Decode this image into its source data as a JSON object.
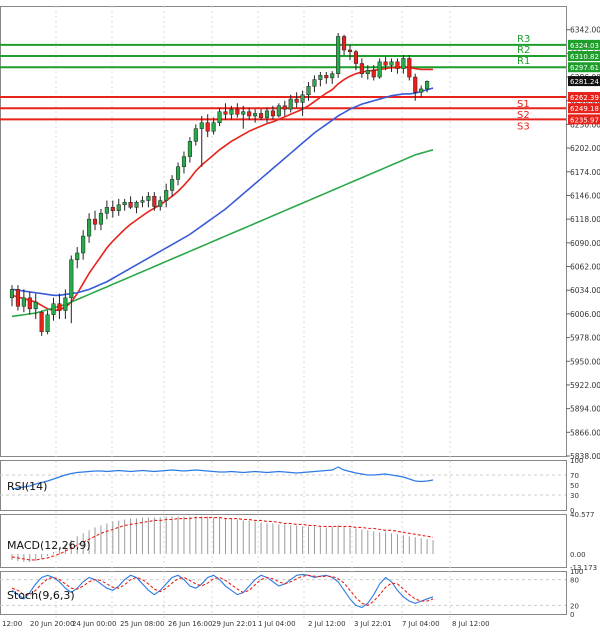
{
  "chart_data": [
    {
      "type": "candlestick",
      "panel": "price",
      "ylim": [
        5838,
        6370
      ],
      "y_ticks": [
        6342,
        6314,
        6286,
        6258,
        6230,
        6202,
        6174,
        6146,
        6118,
        6090,
        6062,
        6034,
        6006,
        5978,
        5950,
        5922,
        5894,
        5866,
        5838
      ],
      "x_ticks": [
        "12:00",
        "20 Jun 20:00",
        "24 Jun 00:00",
        "25 Jun 08:00",
        "26 Jun 16:00",
        "29 Jun 22:01",
        "1 Jul 04:00",
        "2 Jul 12:00",
        "3 Jul 22:01",
        "7 Jul 04:00",
        "8 Jul 12:00"
      ],
      "last_price": 6281.24,
      "candles": [
        {
          "o": 6025,
          "h": 6040,
          "l": 6015,
          "c": 6035
        },
        {
          "o": 6035,
          "h": 6040,
          "l": 6010,
          "c": 6015
        },
        {
          "o": 6015,
          "h": 6035,
          "l": 6008,
          "c": 6025
        },
        {
          "o": 6025,
          "h": 6032,
          "l": 6005,
          "c": 6012
        },
        {
          "o": 6012,
          "h": 6030,
          "l": 6000,
          "c": 6020
        },
        {
          "o": 6008,
          "h": 6010,
          "l": 5980,
          "c": 5985
        },
        {
          "o": 5985,
          "h": 6010,
          "l": 5982,
          "c": 6005
        },
        {
          "o": 6005,
          "h": 6025,
          "l": 5998,
          "c": 6018
        },
        {
          "o": 6018,
          "h": 6030,
          "l": 6000,
          "c": 6010
        },
        {
          "o": 6010,
          "h": 6035,
          "l": 6000,
          "c": 6025
        },
        {
          "o": 6025,
          "h": 6075,
          "l": 5995,
          "c": 6070
        },
        {
          "o": 6070,
          "h": 6085,
          "l": 6060,
          "c": 6078
        },
        {
          "o": 6078,
          "h": 6105,
          "l": 6070,
          "c": 6098
        },
        {
          "o": 6098,
          "h": 6125,
          "l": 6090,
          "c": 6118
        },
        {
          "o": 6118,
          "h": 6128,
          "l": 6105,
          "c": 6112
        },
        {
          "o": 6112,
          "h": 6130,
          "l": 6105,
          "c": 6125
        },
        {
          "o": 6125,
          "h": 6140,
          "l": 6118,
          "c": 6132
        },
        {
          "o": 6132,
          "h": 6140,
          "l": 6120,
          "c": 6128
        },
        {
          "o": 6128,
          "h": 6142,
          "l": 6122,
          "c": 6135
        },
        {
          "o": 6135,
          "h": 6142,
          "l": 6128,
          "c": 6138
        },
        {
          "o": 6138,
          "h": 6145,
          "l": 6130,
          "c": 6132
        },
        {
          "o": 6132,
          "h": 6140,
          "l": 6125,
          "c": 6138
        },
        {
          "o": 6138,
          "h": 6145,
          "l": 6132,
          "c": 6140
        },
        {
          "o": 6140,
          "h": 6150,
          "l": 6132,
          "c": 6145
        },
        {
          "o": 6145,
          "h": 6150,
          "l": 6128,
          "c": 6133
        },
        {
          "o": 6133,
          "h": 6145,
          "l": 6128,
          "c": 6140
        },
        {
          "o": 6140,
          "h": 6160,
          "l": 6132,
          "c": 6152
        },
        {
          "o": 6152,
          "h": 6170,
          "l": 6145,
          "c": 6165
        },
        {
          "o": 6165,
          "h": 6185,
          "l": 6158,
          "c": 6180
        },
        {
          "o": 6180,
          "h": 6198,
          "l": 6172,
          "c": 6192
        },
        {
          "o": 6192,
          "h": 6215,
          "l": 6185,
          "c": 6210
        },
        {
          "o": 6210,
          "h": 6230,
          "l": 6205,
          "c": 6225
        },
        {
          "o": 6225,
          "h": 6240,
          "l": 6180,
          "c": 6232
        },
        {
          "o": 6232,
          "h": 6242,
          "l": 6215,
          "c": 6222
        },
        {
          "o": 6222,
          "h": 6238,
          "l": 6218,
          "c": 6232
        },
        {
          "o": 6232,
          "h": 6250,
          "l": 6228,
          "c": 6245
        },
        {
          "o": 6245,
          "h": 6255,
          "l": 6235,
          "c": 6242
        },
        {
          "o": 6242,
          "h": 6252,
          "l": 6236,
          "c": 6248
        },
        {
          "o": 6248,
          "h": 6255,
          "l": 6238,
          "c": 6242
        },
        {
          "o": 6242,
          "h": 6252,
          "l": 6225,
          "c": 6245
        },
        {
          "o": 6245,
          "h": 6250,
          "l": 6235,
          "c": 6240
        },
        {
          "o": 6240,
          "h": 6248,
          "l": 6232,
          "c": 6243
        },
        {
          "o": 6243,
          "h": 6248,
          "l": 6235,
          "c": 6238
        },
        {
          "o": 6238,
          "h": 6250,
          "l": 6232,
          "c": 6246
        },
        {
          "o": 6246,
          "h": 6252,
          "l": 6236,
          "c": 6240
        },
        {
          "o": 6240,
          "h": 6255,
          "l": 6238,
          "c": 6252
        },
        {
          "o": 6252,
          "h": 6258,
          "l": 6240,
          "c": 6248
        },
        {
          "o": 6248,
          "h": 6265,
          "l": 6244,
          "c": 6260
        },
        {
          "o": 6260,
          "h": 6268,
          "l": 6250,
          "c": 6256
        },
        {
          "o": 6256,
          "h": 6270,
          "l": 6240,
          "c": 6265
        },
        {
          "o": 6265,
          "h": 6280,
          "l": 6258,
          "c": 6275
        },
        {
          "o": 6275,
          "h": 6288,
          "l": 6268,
          "c": 6283
        },
        {
          "o": 6283,
          "h": 6292,
          "l": 6275,
          "c": 6288
        },
        {
          "o": 6288,
          "h": 6292,
          "l": 6278,
          "c": 6285
        },
        {
          "o": 6285,
          "h": 6293,
          "l": 6278,
          "c": 6290
        },
        {
          "o": 6290,
          "h": 6338,
          "l": 6285,
          "c": 6334
        },
        {
          "o": 6334,
          "h": 6336,
          "l": 6312,
          "c": 6318
        },
        {
          "o": 6318,
          "h": 6324,
          "l": 6306,
          "c": 6316
        },
        {
          "o": 6316,
          "h": 6318,
          "l": 6294,
          "c": 6302
        },
        {
          "o": 6302,
          "h": 6308,
          "l": 6285,
          "c": 6290
        },
        {
          "o": 6290,
          "h": 6300,
          "l": 6283,
          "c": 6294
        },
        {
          "o": 6294,
          "h": 6300,
          "l": 6282,
          "c": 6286
        },
        {
          "o": 6286,
          "h": 6308,
          "l": 6284,
          "c": 6304
        },
        {
          "o": 6304,
          "h": 6310,
          "l": 6294,
          "c": 6300
        },
        {
          "o": 6300,
          "h": 6308,
          "l": 6292,
          "c": 6304
        },
        {
          "o": 6304,
          "h": 6308,
          "l": 6290,
          "c": 6296
        },
        {
          "o": 6296,
          "h": 6312,
          "l": 6290,
          "c": 6308
        },
        {
          "o": 6308,
          "h": 6312,
          "l": 6282,
          "c": 6286
        },
        {
          "o": 6286,
          "h": 6290,
          "l": 6258,
          "c": 6268
        },
        {
          "o": 6268,
          "h": 6276,
          "l": 6262,
          "c": 6272
        },
        {
          "o": 6272,
          "h": 6282,
          "l": 6268,
          "c": 6281
        }
      ],
      "moving_averages": [
        {
          "color": "#e8221b",
          "values": [
            6028,
            6026,
            6024,
            6022,
            6020,
            6016,
            6012,
            6010,
            6011,
            6014,
            6020,
            6030,
            6042,
            6054,
            6064,
            6074,
            6084,
            6092,
            6099,
            6106,
            6112,
            6117,
            6122,
            6127,
            6131,
            6135,
            6140,
            6145,
            6151,
            6158,
            6166,
            6175,
            6182,
            6188,
            6194,
            6200,
            6205,
            6210,
            6214,
            6218,
            6222,
            6225,
            6228,
            6231,
            6233,
            6236,
            6239,
            6242,
            6245,
            6248,
            6252,
            6257,
            6262,
            6267,
            6271,
            6278,
            6283,
            6287,
            6290,
            6292,
            6293,
            6294,
            6295,
            6296,
            6297,
            6297,
            6298,
            6297,
            6296,
            6295,
            6295,
            6295
          ]
        },
        {
          "color": "#3a5bd9",
          "values": [
            6035,
            6034,
            6033,
            6032,
            6031,
            6030,
            6029,
            6028,
            6028,
            6029,
            6030,
            6031,
            6033,
            6035,
            6038,
            6041,
            6044,
            6048,
            6052,
            6056,
            6060,
            6064,
            6068,
            6072,
            6076,
            6080,
            6084,
            6088,
            6092,
            6096,
            6100,
            6105,
            6110,
            6115,
            6120,
            6125,
            6130,
            6136,
            6142,
            6148,
            6154,
            6160,
            6166,
            6172,
            6178,
            6184,
            6190,
            6196,
            6202,
            6208,
            6214,
            6220,
            6225,
            6230,
            6235,
            6240,
            6244,
            6248,
            6251,
            6254,
            6256,
            6258,
            6260,
            6262,
            6264,
            6265,
            6266,
            6266,
            6267,
            6269,
            6271,
            6273
          ]
        },
        {
          "color": "#2aa84a",
          "values": [
            6003,
            6004,
            6005,
            6006,
            6007,
            6009,
            6011,
            6013,
            6015,
            6017,
            6020,
            6023,
            6026,
            6029,
            6032,
            6035,
            6038,
            6041,
            6044,
            6047,
            6050,
            6053,
            6056,
            6059,
            6062,
            6065,
            6068,
            6071,
            6074,
            6077,
            6080,
            6083,
            6086,
            6089,
            6092,
            6095,
            6098,
            6101,
            6104,
            6107,
            6110,
            6113,
            6116,
            6119,
            6122,
            6125,
            6128,
            6131,
            6134,
            6137,
            6140,
            6143,
            6146,
            6149,
            6152,
            6155,
            6158,
            6161,
            6164,
            6167,
            6170,
            6173,
            6176,
            6179,
            6182,
            6185,
            6188,
            6191,
            6194,
            6196,
            6198,
            6200
          ]
        }
      ],
      "levels": [
        {
          "label": "R3",
          "value": 6324.03,
          "value_text": "6324.03",
          "color": "#1e9e2a"
        },
        {
          "label": "R2",
          "value": 6310.82,
          "value_text": "6310.82",
          "color": "#1e9e2a"
        },
        {
          "label": "R1",
          "value": 6297.61,
          "value_text": "6297.61",
          "color": "#1e9e2a"
        },
        {
          "label": "S1",
          "value": 6262.39,
          "value_text": "6262.39",
          "color": "#e8221b"
        },
        {
          "label": "S2",
          "value": 6249.18,
          "value_text": "6249.18",
          "color": "#e8221b"
        },
        {
          "label": "S3",
          "value": 6235.97,
          "value_text": "6235.97",
          "color": "#e8221b"
        }
      ],
      "extra_axis_labels": [
        "6286.00",
        "6270.00",
        "6250.00"
      ]
    },
    {
      "type": "line",
      "panel": "rsi",
      "label": "RSI(14)",
      "ylim": [
        0,
        100
      ],
      "y_ticks": [
        100,
        70,
        50,
        30,
        0
      ],
      "values": [
        42,
        44,
        46,
        48,
        52,
        55,
        58,
        62,
        66,
        70,
        73,
        75,
        76,
        77,
        78,
        78,
        77,
        78,
        79,
        78,
        77,
        78,
        79,
        78,
        77,
        78,
        79,
        80,
        79,
        78,
        79,
        80,
        79,
        78,
        77,
        76,
        76,
        77,
        76,
        75,
        76,
        77,
        76,
        75,
        76,
        77,
        76,
        75,
        74,
        75,
        76,
        77,
        78,
        79,
        80,
        86,
        80,
        77,
        74,
        72,
        70,
        70,
        71,
        72,
        70,
        68,
        66,
        62,
        58,
        57,
        58,
        60
      ],
      "color": "#2c7be5"
    },
    {
      "type": "bar",
      "panel": "macd",
      "label": "MACD(12,26,9)",
      "ylim": [
        -13.173,
        40.577
      ],
      "y_ticks": [
        "40.577",
        "0.00",
        "-13.173"
      ],
      "histogram": [
        -6,
        -7,
        -8,
        -8,
        -7,
        -5,
        -2,
        2,
        6,
        10,
        14,
        18,
        21,
        24,
        27,
        29,
        31,
        33,
        34,
        35,
        36,
        36,
        37,
        37,
        37,
        37,
        38,
        38,
        38,
        38,
        38,
        38,
        38,
        38,
        37,
        37,
        36,
        36,
        35,
        34,
        34,
        33,
        32,
        31,
        31,
        30,
        30,
        29,
        29,
        28,
        28,
        28,
        27,
        27,
        28,
        29,
        28,
        27,
        26,
        25,
        24,
        23,
        22,
        22,
        21,
        20,
        19,
        18,
        17,
        16,
        15,
        14
      ],
      "signal": [
        -3,
        -4,
        -5,
        -6,
        -6,
        -5,
        -4,
        -2,
        0,
        3,
        6,
        9,
        12,
        15,
        18,
        21,
        23,
        25,
        27,
        29,
        30,
        31,
        32,
        33,
        34,
        34,
        35,
        35,
        36,
        36,
        36,
        37,
        37,
        37,
        37,
        37,
        36,
        36,
        36,
        35,
        35,
        34,
        34,
        33,
        33,
        32,
        31,
        31,
        30,
        30,
        29,
        29,
        28,
        28,
        28,
        28,
        28,
        28,
        27,
        27,
        26,
        26,
        25,
        24,
        24,
        23,
        22,
        21,
        20,
        19,
        18,
        17
      ],
      "color": "#e8221b"
    },
    {
      "type": "line",
      "panel": "stoch",
      "label": "Stoch(9,6,3)",
      "ylim": [
        0,
        100
      ],
      "y_ticks": [
        100,
        80,
        20,
        0
      ],
      "k": [
        55,
        45,
        35,
        50,
        70,
        85,
        90,
        85,
        75,
        60,
        50,
        60,
        75,
        85,
        80,
        70,
        60,
        55,
        65,
        80,
        90,
        85,
        70,
        55,
        45,
        55,
        70,
        85,
        90,
        80,
        65,
        60,
        70,
        85,
        90,
        80,
        65,
        55,
        45,
        50,
        65,
        80,
        90,
        85,
        75,
        65,
        70,
        80,
        90,
        92,
        90,
        85,
        88,
        90,
        85,
        75,
        55,
        35,
        20,
        15,
        25,
        45,
        70,
        85,
        75,
        55,
        40,
        30,
        25,
        30,
        35,
        40
      ],
      "d": [
        60,
        55,
        45,
        45,
        55,
        70,
        82,
        85,
        80,
        70,
        60,
        58,
        65,
        75,
        80,
        78,
        70,
        62,
        60,
        68,
        80,
        85,
        80,
        70,
        58,
        52,
        60,
        72,
        82,
        85,
        78,
        70,
        65,
        72,
        82,
        85,
        78,
        68,
        58,
        50,
        55,
        68,
        80,
        85,
        82,
        75,
        70,
        75,
        82,
        88,
        90,
        88,
        87,
        88,
        87,
        82,
        72,
        55,
        38,
        25,
        20,
        30,
        45,
        62,
        72,
        70,
        58,
        45,
        35,
        30,
        30,
        35
      ],
      "color_k": "#2c7be5",
      "color_d": "#e8221b"
    }
  ]
}
